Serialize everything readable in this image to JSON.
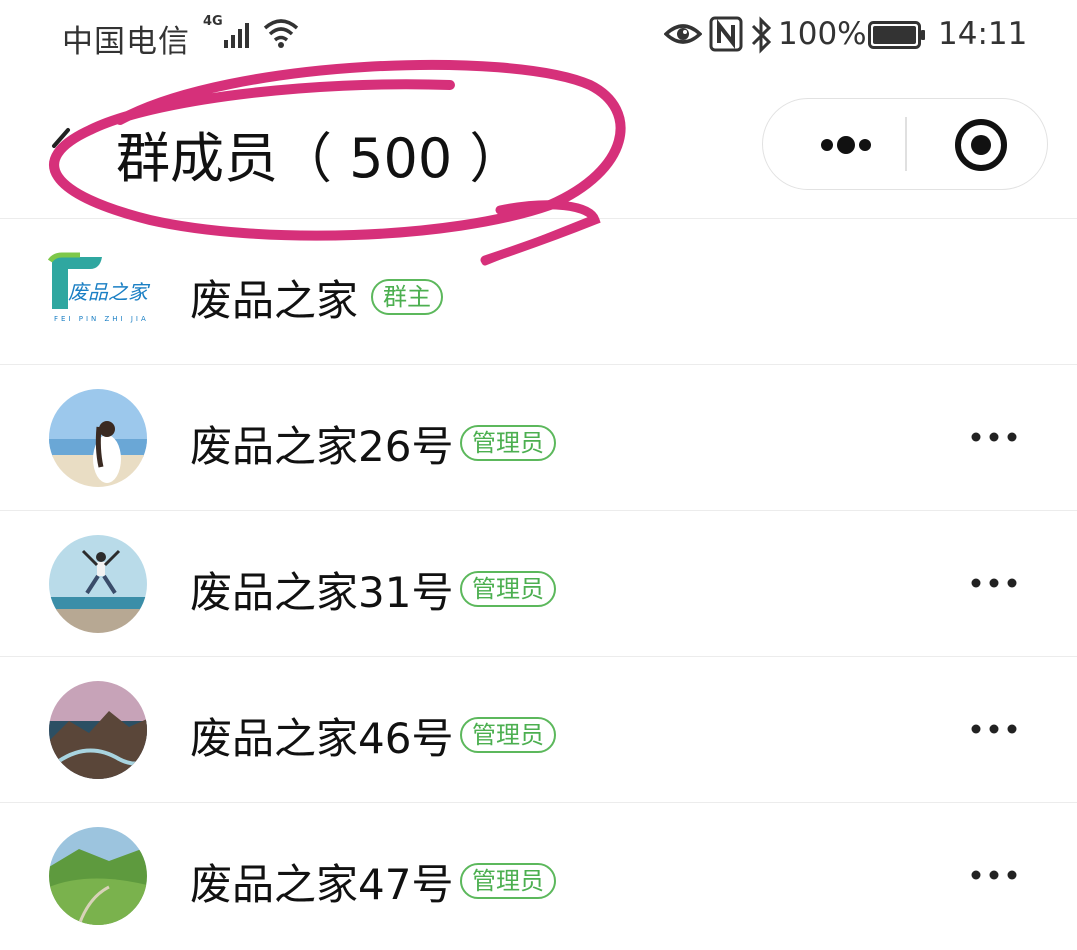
{
  "status_bar": {
    "carrier": "中国电信",
    "network": "4G",
    "battery": "100%",
    "time": "14:11",
    "icons": [
      "signal-icon",
      "wifi-icon",
      "eye-icon",
      "nfc-icon",
      "bluetooth-icon",
      "battery-icon"
    ]
  },
  "nav": {
    "title": "群成员（ 500 ）",
    "back_icon": "chevron-left-icon",
    "menu_icon": "more-dots-icon",
    "close_icon": "target-circle-icon"
  },
  "colors": {
    "badge_green": "#4caf50",
    "annotation_magenta": "#d6307a"
  },
  "members": [
    {
      "name": "废品之家",
      "role": "群主",
      "avatar": "logo",
      "has_more": false
    },
    {
      "name": "废品之家26号",
      "role": "管理员",
      "avatar": "photo-woman-beach",
      "has_more": true
    },
    {
      "name": "废品之家31号",
      "role": "管理员",
      "avatar": "photo-person-jumping",
      "has_more": true
    },
    {
      "name": "废品之家46号",
      "role": "管理员",
      "avatar": "photo-sea-cliffs",
      "has_more": true
    },
    {
      "name": "废品之家47号",
      "role": "管理员",
      "avatar": "photo-green-hills",
      "has_more": true
    }
  ],
  "logo_text": "废品之家"
}
